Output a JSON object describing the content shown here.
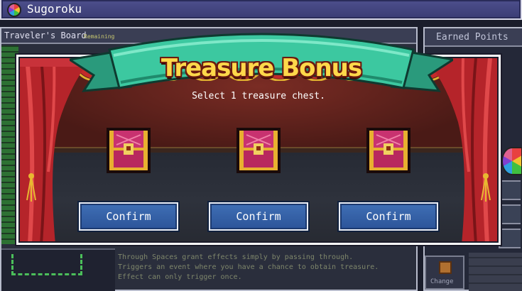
{
  "window": {
    "title": "Sugoroku",
    "icon": "roulette-wheel-icon"
  },
  "board": {
    "title": "Traveler's Board",
    "remaining_label": "Remaining"
  },
  "description": {
    "lines": [
      "Through Spaces grant effects simply by passing through.",
      "Triggers an event where you have a chance to obtain treasure.",
      "Effect can only trigger once."
    ]
  },
  "points_panel": {
    "title": "Earned Points"
  },
  "change_button": {
    "label": "Change"
  },
  "modal": {
    "banner_title": "Treasure Bonus",
    "prompt": "Select 1 treasure chest.",
    "chests": [
      {
        "icon": "treasure-chest-icon",
        "confirm_label": "Confirm"
      },
      {
        "icon": "treasure-chest-icon",
        "confirm_label": "Confirm"
      },
      {
        "icon": "treasure-chest-icon",
        "confirm_label": "Confirm"
      }
    ]
  },
  "colors": {
    "banner_teal": "#3cc8a0",
    "curtain_red": "#c3282a",
    "button_blue": "#3f6fb5",
    "title_gold": "#ffd84a"
  }
}
